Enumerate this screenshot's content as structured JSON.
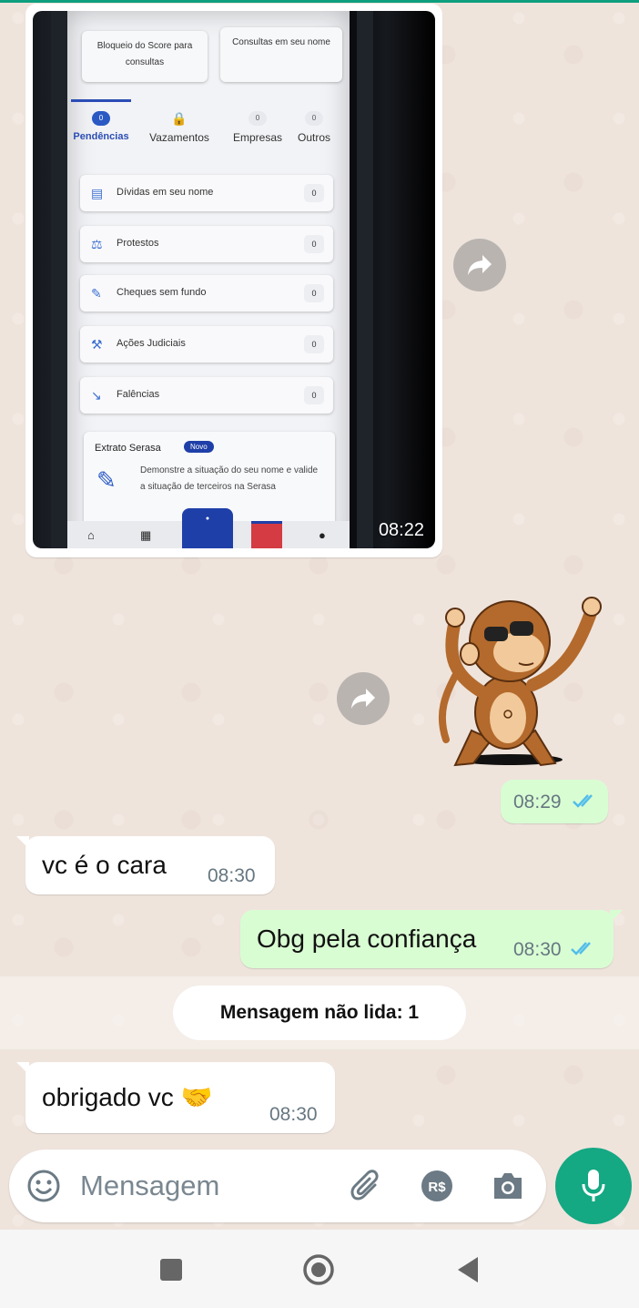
{
  "image_message": {
    "time": "08:22",
    "screen": {
      "top_cards": [
        "Bloqueio do Score para consultas",
        "Consultas em seu nome"
      ],
      "tabs": [
        {
          "label": "Pendências",
          "count": "0"
        },
        {
          "label": "Vazamentos",
          "count": ""
        },
        {
          "label": "Empresas",
          "count": "0"
        },
        {
          "label": "Outros",
          "count": "0"
        }
      ],
      "rows": [
        {
          "label": "Dívidas em seu nome",
          "count": "0"
        },
        {
          "label": "Protestos",
          "count": "0"
        },
        {
          "label": "Cheques sem fundo",
          "count": "0"
        },
        {
          "label": "Ações Judiciais",
          "count": "0"
        },
        {
          "label": "Falências",
          "count": "0"
        }
      ],
      "extrato": {
        "title": "Extrato Serasa",
        "badge": "Novo",
        "description": "Demonstre a situação do seu nome e valide a situação de terceiros na Serasa"
      }
    }
  },
  "sticker_message": {
    "time": "08:29",
    "status": "read"
  },
  "messages": [
    {
      "direction": "incoming",
      "text": "vc é  o cara",
      "time": "08:30"
    },
    {
      "direction": "outgoing",
      "text": "Obg pela confiança",
      "time": "08:30",
      "status": "read"
    },
    {
      "direction": "incoming",
      "text": "obrigado  vc 🤝",
      "time": "08:30"
    }
  ],
  "unread_divider": "Mensagem não lida: 1",
  "composer": {
    "placeholder": "Mensagem"
  },
  "icons": {
    "emoji": "emoji-icon",
    "attach": "paperclip-icon",
    "payment": "real-currency-icon",
    "camera": "camera-icon",
    "mic": "microphone-icon",
    "forward": "forward-icon"
  },
  "colors": {
    "accent": "#14a883",
    "outgoing_bubble": "#d9fdd3",
    "incoming_bubble": "#ffffff",
    "read_ticks": "#53bdeb",
    "chat_bg": "#efe4dc"
  }
}
